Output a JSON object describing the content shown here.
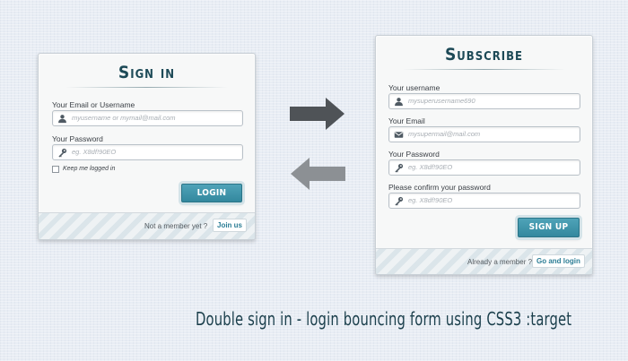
{
  "signin": {
    "title": "Sign in",
    "email_label": "Your Email or Username",
    "email_placeholder": "myusername or mymail@mail.com",
    "password_label": "Your Password",
    "password_placeholder": "eg. X8df!90EO",
    "remember_label": "Keep me logged in",
    "login_button": "LOGIN",
    "footer_text": "Not a member yet ?",
    "footer_link": "Join us"
  },
  "subscribe": {
    "title": "Subscribe",
    "username_label": "Your username",
    "username_placeholder": "mysuperusername690",
    "email_label": "Your Email",
    "email_placeholder": "mysupermail@mail.com",
    "password_label": "Your Password",
    "password_placeholder": "eg. X8df!90EO",
    "confirm_label": "Please confirm your password",
    "confirm_placeholder": "eg. X8df!90EO",
    "signup_button": "SIGN UP",
    "footer_text": "Already a member ?",
    "footer_link": "Go and login"
  },
  "caption": "Double sign in - login bouncing form  using CSS3 :target",
  "icons": {
    "arrow_right": "arrow-right-icon",
    "arrow_left": "arrow-left-icon",
    "user": "user-icon",
    "key": "key-icon",
    "mail": "mail-icon"
  },
  "colors": {
    "accent": "#3a90a6",
    "title": "#1d4a57",
    "link": "#2b7d95",
    "arrow_dark": "#4f5357",
    "arrow_light": "#8c9094"
  }
}
